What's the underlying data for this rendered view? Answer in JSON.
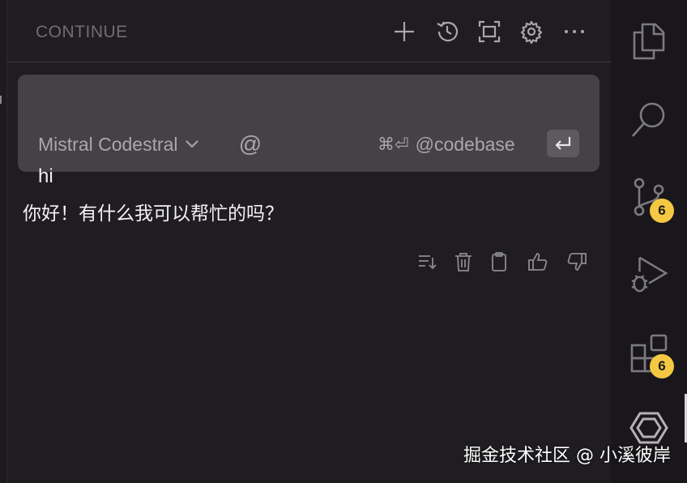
{
  "header": {
    "title": "CONTINUE",
    "buttons": [
      "plus-icon",
      "history-icon",
      "fullscreen-icon",
      "gear-icon",
      "more-icon"
    ]
  },
  "input": {
    "value": "hi",
    "model": "Mistral Codestral",
    "at_symbol": "@",
    "shortcut": "⌘⏎",
    "codebase": "@codebase"
  },
  "response": {
    "text": "你好！有什么我可以帮忙的吗？",
    "actions": [
      "insert-icon",
      "trash-icon",
      "clipboard-icon",
      "thumbs-up-icon",
      "thumbs-down-icon"
    ]
  },
  "activity_bar": {
    "items": [
      {
        "name": "explorer-icon"
      },
      {
        "name": "search-icon"
      },
      {
        "name": "source-control-icon",
        "badge": "6"
      },
      {
        "name": "run-debug-icon"
      },
      {
        "name": "extensions-icon",
        "badge": "6"
      },
      {
        "name": "continue-icon"
      }
    ]
  },
  "watermark": "掘金技术社区 @ 小溪彼岸",
  "colors": {
    "background": "#1f1d21",
    "card": "#444247",
    "badge": "#f5c842"
  }
}
